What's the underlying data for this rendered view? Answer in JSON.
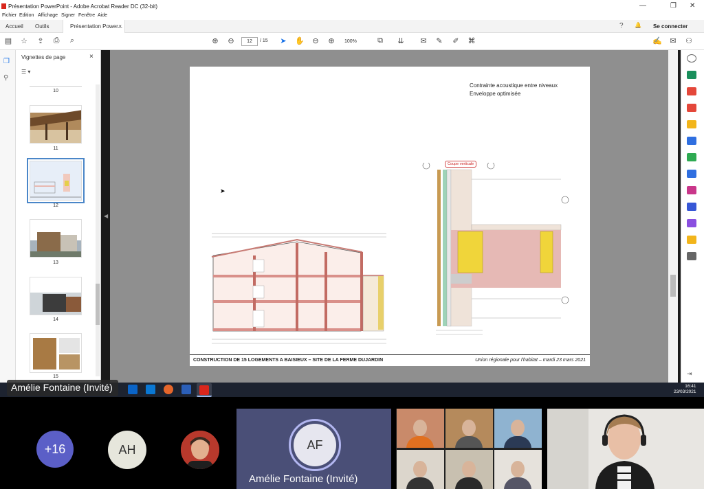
{
  "window": {
    "title": "Présentation PowerPoint - Adobe Acrobat Reader DC (32-bit)",
    "min": "—",
    "max": "❐",
    "close": "✕"
  },
  "menu": [
    "Fichier",
    "Edition",
    "Affichage",
    "Signer",
    "Fenêtre",
    "Aide"
  ],
  "tabs": {
    "home": "Accueil",
    "tools": "Outils",
    "document": "Présentation Power...",
    "close": "×",
    "help": "?",
    "bell": "🔔",
    "login": "Se connecter"
  },
  "toolbar": {
    "current_page": "12",
    "page_sep": "/ 15",
    "zoom": "100%"
  },
  "thumbnails": {
    "title": "Vignettes de page",
    "close": "×",
    "options": "☰ ▾",
    "pages": [
      {
        "label": "10",
        "selected": false
      },
      {
        "label": "11",
        "selected": false
      },
      {
        "label": "12",
        "selected": true
      },
      {
        "label": "13",
        "selected": false
      },
      {
        "label": "14",
        "selected": false
      },
      {
        "label": "15",
        "selected": false
      }
    ]
  },
  "page": {
    "note_line1": "Contrainte acoustique entre niveaux",
    "note_line2": "Enveloppe optimisée",
    "section_label": "Coupe verticale",
    "footer_left": "CONSTRUCTION DE 15 LOGEMENTS A BAISIEUX – SITE DE LA FERME DUJARDIN",
    "footer_right": "Union régionale pour l'habitat – mardi 23 mars 2021"
  },
  "taskbar": {
    "time": "16:41",
    "date": "23/03/2021"
  },
  "meeting": {
    "presenter_label": "Amélie Fontaine (Invité)",
    "overflow_count": "+16",
    "avatar_ah": "AH",
    "avatar_af": "AF",
    "af_name": "Amélie Fontaine (Invité)"
  },
  "colors": {
    "overflow": "#5b5fc7",
    "ah_bg": "#e6e6dc",
    "af_tile": "#4a4f77",
    "pdf_red": "#d9261c"
  }
}
